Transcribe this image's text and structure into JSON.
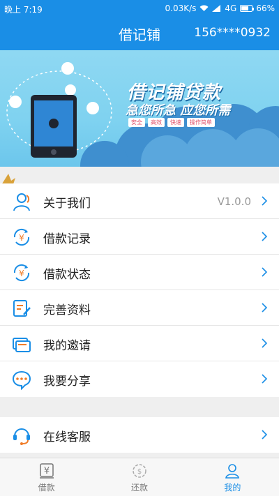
{
  "status": {
    "time": "晚上 7:19",
    "speed": "0.03K/s",
    "network": "4G",
    "battery": "66%"
  },
  "header": {
    "title": "借记铺",
    "phone": "156****0932"
  },
  "banner": {
    "title": "借记铺贷款",
    "slogan": "急您所急 应您所需",
    "tags": [
      "安全",
      "高效",
      "快速",
      "操作简单"
    ]
  },
  "menu": [
    {
      "label": "关于我们",
      "value": "V1.0.0",
      "icon": "about-us-icon"
    },
    {
      "label": "借款记录",
      "icon": "loan-record-icon"
    },
    {
      "label": "借款状态",
      "icon": "loan-status-icon"
    },
    {
      "label": "完善资料",
      "icon": "edit-profile-icon"
    },
    {
      "label": "我的邀请",
      "icon": "invite-card-icon"
    },
    {
      "label": "我要分享",
      "icon": "share-chat-icon"
    }
  ],
  "service": {
    "label": "在线客服",
    "icon": "customer-service-icon"
  },
  "nav": [
    {
      "label": "借款",
      "icon": "yen-icon"
    },
    {
      "label": "还款",
      "icon": "repay-icon"
    },
    {
      "label": "我的",
      "icon": "person-icon",
      "active": true
    }
  ],
  "colors": {
    "primary": "#1a8ee6",
    "accent": "#f07c28"
  }
}
